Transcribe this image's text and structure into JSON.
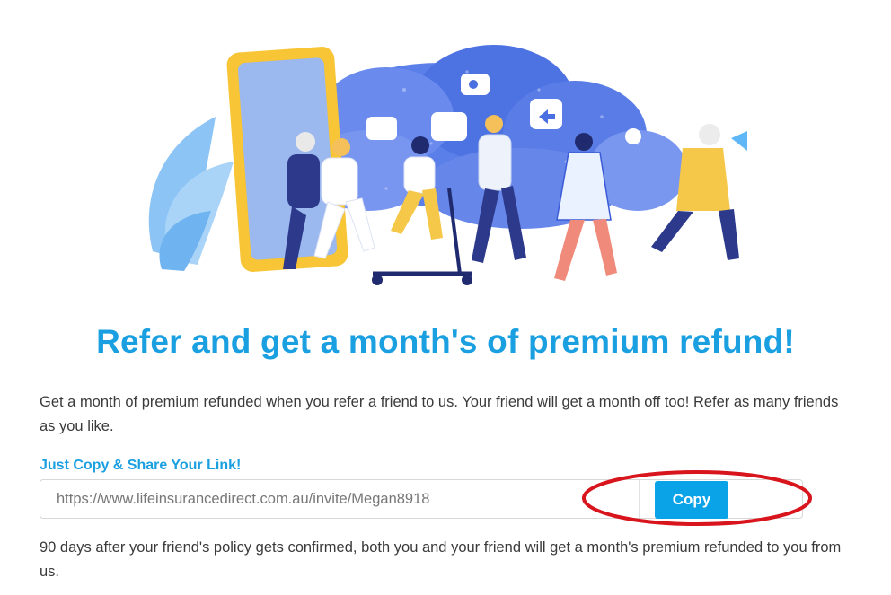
{
  "hero": {
    "illustration": "people-walking-out-of-phone-illustration"
  },
  "headline": "Refer and get a month's of premium refund!",
  "description": "Get a month of premium refunded when you refer a friend to us. Your friend will get a month off too! Refer as many friends as you like.",
  "share": {
    "label": "Just Copy & Share Your Link!",
    "invite_link": "https://www.lifeinsurancedirect.com.au/invite/Megan8918",
    "copy_label": "Copy"
  },
  "note": "90 days after your friend's policy gets confirmed, both you and your friend will get a month's premium refunded to you from us.",
  "colors": {
    "accent": "#1a9fe0",
    "button": "#0aa3e8",
    "annotation": "#d8141c",
    "text": "#3a3a3a"
  }
}
